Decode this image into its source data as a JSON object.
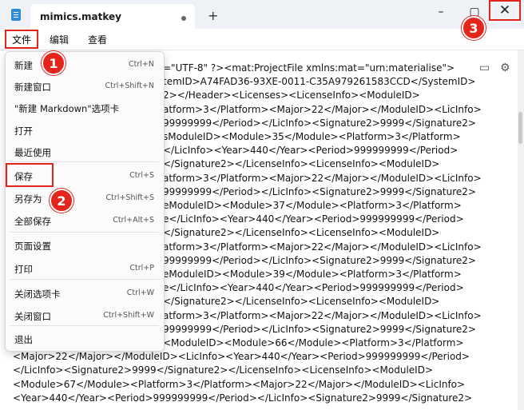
{
  "window": {
    "tab_title": "mimics.matkey",
    "new_tab": "+",
    "minimize": "–",
    "maximize": "▢",
    "close": "✕"
  },
  "menu": {
    "file": "文件",
    "edit": "编辑",
    "view": "查看"
  },
  "file_menu": [
    {
      "label": "新建",
      "shortcut": "Ctrl+N"
    },
    {
      "label": "新建窗口",
      "shortcut": "Ctrl+Shift+N"
    },
    {
      "label": "\"新建 Markdown\"选项卡",
      "shortcut": ""
    },
    {
      "label": "打开",
      "shortcut": ""
    },
    {
      "label": "最近使用",
      "shortcut": ""
    },
    {
      "label": "保存",
      "shortcut": "Ctrl+S"
    },
    {
      "label": "另存为",
      "shortcut": "Ctrl+Shift+S"
    },
    {
      "label": "全部保存",
      "shortcut": "Ctrl+Alt+S"
    },
    {
      "label": "页面设置",
      "shortcut": ""
    },
    {
      "label": "打印",
      "shortcut": "Ctrl+P"
    },
    {
      "label": "关闭选项卡",
      "shortcut": "Ctrl+W"
    },
    {
      "label": "关闭窗口",
      "shortcut": "Ctrl+Shift+W"
    },
    {
      "label": "退出",
      "shortcut": ""
    }
  ],
  "markers": [
    "1",
    "2",
    "3"
  ],
  "editor_lines": [
    "=\"UTF-8\" ?><mat:ProjectFile xmlns:mat=\"urn:materialise\">",
    "temID>A74FAD36-93XE-0011-C35A979261583CCD</SystemID>",
    "2></Header><Licenses><LicenseInfo><ModuleID>",
    "atform>3</Platform><Major>22</Major></ModuleID><LicInfo>",
    "99999999</Period></LicInfo><Signature2>9999</Signature2>",
    "sModuleID><Module>35</Module><Platform>3</Platform>",
    "</LicInfo><Year>440</Year><Period>999999999</Period>",
    "</Signature2></LicenseInfo><LicenseInfo><ModuleID>",
    "atform>3</Platform><Major>22</Major></ModuleID><LicInfo>",
    "99999999</Period></LicInfo><Signature2>9999</Signature2>",
    "eModuleID><Module>37</Module><Platform>3</Platform>",
    "e</LicInfo><Year>440</Year><Period>999999999</Period>",
    "</Signature2></LicenseInfo><LicenseInfo><ModuleID>",
    "atform>3</Platform><Major>22</Major></ModuleID><LicInfo>",
    "99999999</Period></LicInfo><Signature2>9999</Signature2>",
    "eModuleID><Module>39</Module><Platform>3</Platform>",
    "e</LicInfo><Year>440</Year><Period>999999999</Period>",
    "</Signature2></LicenseInfo><LicenseInfo><ModuleID>",
    "atform>3</Platform><Major>22</Major></ModuleID><LicInfo>",
    "99999999</Period></LicInfo><Signature2>9999</Signature2>",
    "<ModuleID><Module>66</Module><Platform>3</Platform>",
    "<Major>22</Major></ModuleID><LicInfo><Year>440</Year><Period>999999999</Period>",
    "</LicInfo><Signature2>9999</Signature2></LicenseInfo><LicenseInfo><ModuleID>",
    "<Module>67</Module><Platform>3</Platform><Major>22</Major></ModuleID><LicInfo>",
    "<Year>440</Year><Period>999999999</Period></LicInfo><Signature2>9999</Signature2>"
  ]
}
